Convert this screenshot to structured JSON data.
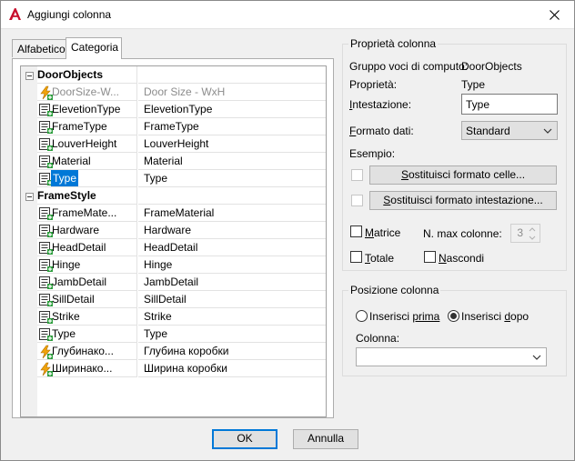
{
  "window": {
    "title": "Aggiungi colonna"
  },
  "tabs": [
    {
      "label": "Alfabetico"
    },
    {
      "label": "Categoria"
    }
  ],
  "grid": {
    "groups": [
      {
        "name": "DoorObjects",
        "rows": [
          {
            "name": "DoorSize-W...",
            "value": "Door Size - WxH",
            "icon": "formula-icon",
            "grey": true
          },
          {
            "name": "ElevetionType",
            "value": "ElevetionType",
            "icon": "property-icon"
          },
          {
            "name": "FrameType",
            "value": "FrameType",
            "icon": "property-icon"
          },
          {
            "name": "LouverHeight",
            "value": "LouverHeight",
            "icon": "property-icon"
          },
          {
            "name": "Material",
            "value": "Material",
            "icon": "property-icon"
          },
          {
            "name": "Type",
            "value": "Type",
            "icon": "property-icon",
            "selected": true
          }
        ]
      },
      {
        "name": "FrameStyle",
        "rows": [
          {
            "name": "FrameMate...",
            "value": "FrameMaterial",
            "icon": "property-icon"
          },
          {
            "name": "Hardware",
            "value": "Hardware",
            "icon": "property-icon"
          },
          {
            "name": "HeadDetail",
            "value": "HeadDetail",
            "icon": "property-icon"
          },
          {
            "name": "Hinge",
            "value": "Hinge",
            "icon": "property-icon"
          },
          {
            "name": "JambDetail",
            "value": "JambDetail",
            "icon": "property-icon"
          },
          {
            "name": "SillDetail",
            "value": "SillDetail",
            "icon": "property-icon"
          },
          {
            "name": "Strike",
            "value": "Strike",
            "icon": "property-icon"
          },
          {
            "name": "Type",
            "value": "Type",
            "icon": "property-icon"
          },
          {
            "name": "Глубинако...",
            "value": "Глубина коробки",
            "icon": "formula-icon"
          },
          {
            "name": "Ширинако...",
            "value": "Ширина коробки",
            "icon": "formula-icon"
          }
        ]
      }
    ]
  },
  "column_properties": {
    "title": "Proprietà colonna",
    "group_label": "Gruppo voci di computo:",
    "group_value": "DoorObjects",
    "property_label": "Proprietà:",
    "property_value": "Type",
    "heading_label": "Intestazione:",
    "heading_value": "Type",
    "format_label": "Formato dati:",
    "format_value": "Standard",
    "example_label": "Esempio:",
    "override_cell_button": "Sostituisci formato celle...",
    "override_heading_button": "Sostituisci formato intestazione...",
    "matrix_label": "Matrice",
    "max_columns_label": "N. max colonne:",
    "max_columns_value": "3",
    "total_label": "Totale",
    "hide_label": "Nascondi"
  },
  "column_position": {
    "title": "Posizione colonna",
    "insert_before_label": "Inserisci prima",
    "insert_after_label": "Inserisci dopo",
    "selected": "after",
    "column_label": "Colonna:",
    "column_value": ""
  },
  "footer": {
    "ok_label": "OK",
    "cancel_label": "Annulla"
  },
  "colors": {
    "accent": "#0078d7",
    "app_icon_red": "#c8102e",
    "formula_icon": "#f0a30a"
  }
}
